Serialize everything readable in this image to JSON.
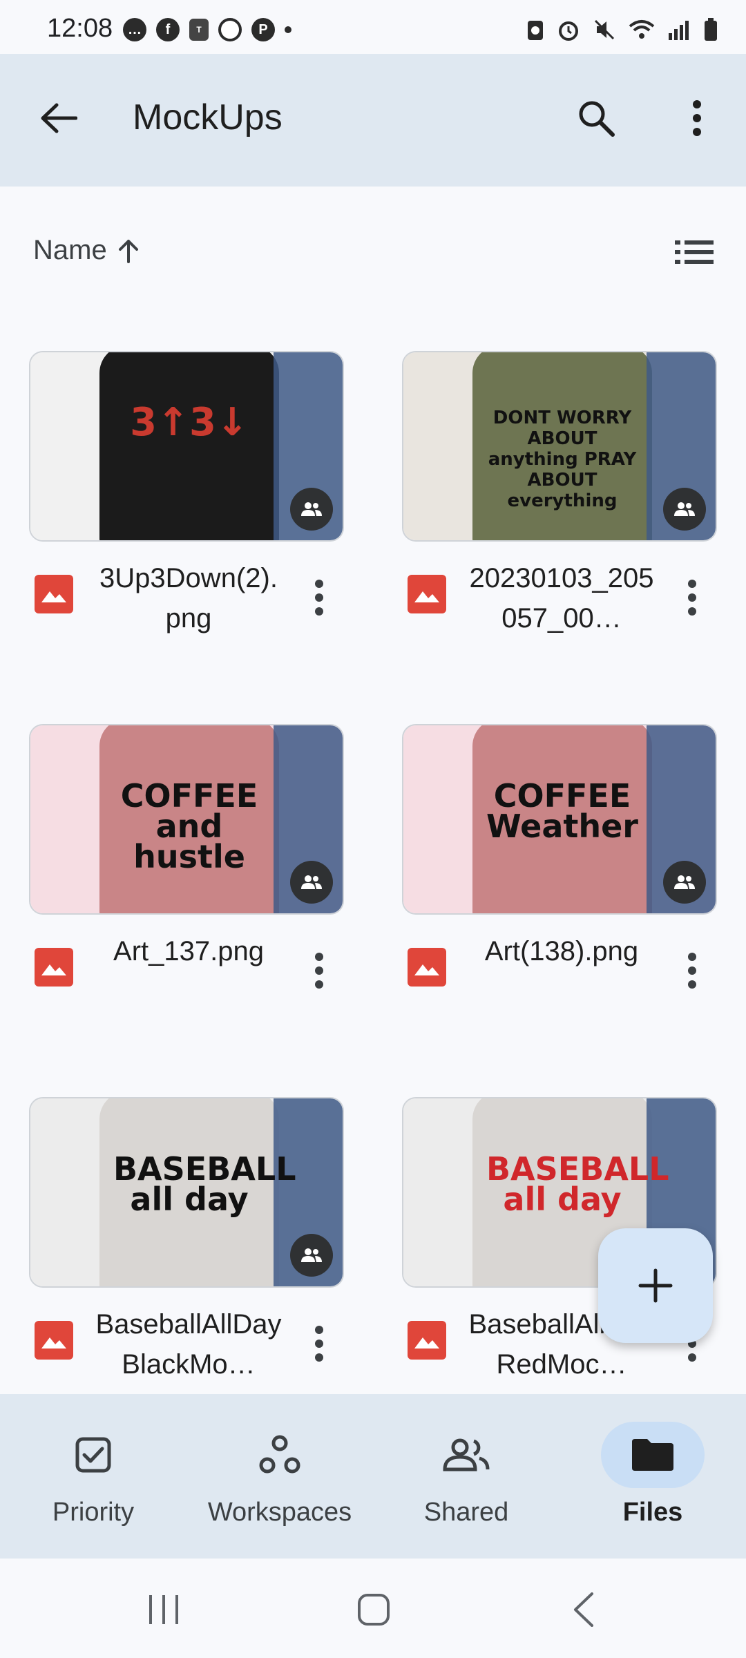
{
  "status_bar": {
    "time": "12:08",
    "left_icons": [
      "chat-icon",
      "facebook-icon",
      "temu-icon",
      "threads-icon",
      "pinterest-icon",
      "dot-icon"
    ],
    "right_icons": [
      "recycle-icon",
      "alarm-icon",
      "mute-icon",
      "wifi-icon",
      "signal-icon",
      "battery-icon"
    ]
  },
  "app_bar": {
    "title": "MockUps"
  },
  "sort": {
    "label": "Name",
    "direction": "ascending"
  },
  "files": [
    {
      "name": "3Up3Down(2).png",
      "thumb_text": "3↑3↓",
      "shirt_color": "#1b1b1b",
      "bg_color": "#f1f1f1",
      "text_color": "#c93a2f"
    },
    {
      "name": "20230103_205057_00…",
      "thumb_text": "DONT WORRY ABOUT anything PRAY ABOUT everything",
      "shirt_color": "#6e7552",
      "bg_color": "#e9e5df",
      "text_color": "#111111"
    },
    {
      "name": "Art_137.png",
      "thumb_text": "COFFEE and hustle",
      "shirt_color": "#c98587",
      "bg_color": "#f6dde3",
      "text_color": "#111111"
    },
    {
      "name": "Art(138).png",
      "thumb_text": "COFFEE Weather",
      "shirt_color": "#c98587",
      "bg_color": "#f6dde3",
      "text_color": "#111111"
    },
    {
      "name": "BaseballAllDayBlackMo…",
      "thumb_text": "BASEBALL all day",
      "shirt_color": "#d9d6d3",
      "bg_color": "#ececec",
      "text_color": "#111111"
    },
    {
      "name": "BaseballAllDayRedMoc…",
      "thumb_text": "BASEBALL all day",
      "shirt_color": "#d9d6d3",
      "bg_color": "#ececec",
      "text_color": "#d0272b"
    }
  ],
  "bottom_nav": [
    {
      "label": "Priority",
      "icon": "checkbox-icon"
    },
    {
      "label": "Workspaces",
      "icon": "workspaces-icon"
    },
    {
      "label": "Shared",
      "icon": "people-icon"
    },
    {
      "label": "Files",
      "icon": "folder-icon",
      "active": true
    }
  ],
  "colors": {
    "accent_red": "#e0463a",
    "app_bar_bg": "#dfe8f1",
    "fab_bg": "#d6e6f8"
  }
}
